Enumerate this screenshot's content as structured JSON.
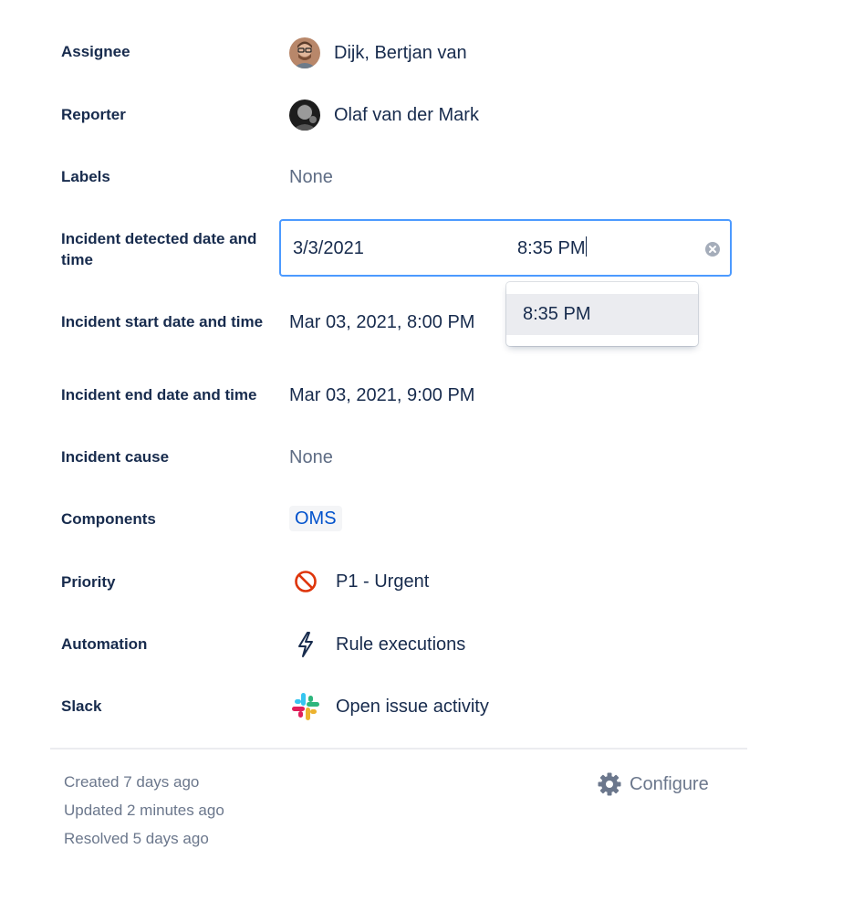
{
  "fields": {
    "assignee": {
      "label": "Assignee",
      "value": "Dijk, Bertjan van"
    },
    "reporter": {
      "label": "Reporter",
      "value": "Olaf van der Mark"
    },
    "labels": {
      "label": "Labels",
      "value": "None"
    },
    "detected": {
      "label": "Incident detected date and time",
      "date_value": "3/3/2021",
      "time_value": "8:35 PM",
      "dropdown_option": "8:35 PM"
    },
    "start": {
      "label": "Incident start date and time",
      "value": "Mar 03, 2021, 8:00 PM"
    },
    "end": {
      "label": "Incident end date and time",
      "value": "Mar 03, 2021, 9:00 PM"
    },
    "cause": {
      "label": "Incident cause",
      "value": "None"
    },
    "components": {
      "label": "Components",
      "value": "OMS"
    },
    "priority": {
      "label": "Priority",
      "value": "P1 - Urgent",
      "icon": "priority-blocker-icon",
      "color": "#de350b"
    },
    "automation": {
      "label": "Automation",
      "value": "Rule executions",
      "icon": "lightning-bolt-icon"
    },
    "slack": {
      "label": "Slack",
      "value": "Open issue activity",
      "icon": "slack-logo-icon"
    }
  },
  "footer": {
    "created": "Created 7 days ago",
    "updated": "Updated 2 minutes ago",
    "resolved": "Resolved 5 days ago",
    "configure_label": "Configure"
  },
  "colors": {
    "text": "#172b4d",
    "muted": "#5e6c84",
    "focus_border": "#4c9aff",
    "link": "#0052cc"
  }
}
